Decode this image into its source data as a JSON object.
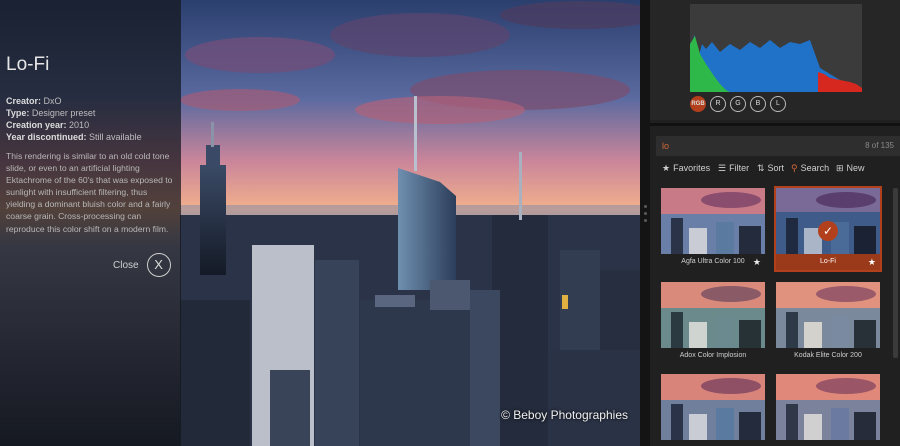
{
  "preset": {
    "name": "Lo-Fi",
    "creator_label": "Creator:",
    "creator": "DxO",
    "type_label": "Type:",
    "type": "Designer preset",
    "creation_year_label": "Creation year:",
    "creation_year": "2010",
    "discontinued_label": "Year discontinued:",
    "discontinued": "Still available",
    "description": "This rendering is similar to an old cold tone slide, or even to an artificial lighting Ektachrome of the 60's that was exposed to sunlight with insufficient filtering, thus yielding a dominant bluish color and a fairly coarse grain. Cross-processing can reproduce this color shift on a modern film.",
    "close_label": "Close",
    "close_icon": "X"
  },
  "photo": {
    "credit": "© Beboy Photographies"
  },
  "histogram": {
    "channels": [
      "RGB",
      "R",
      "G",
      "B",
      "L"
    ],
    "active_channel": "RGB"
  },
  "search": {
    "value": "lo",
    "count": "8 of 135"
  },
  "toolbar": {
    "favorites": "Favorites",
    "filter": "Filter",
    "sort": "Sort",
    "search": "Search",
    "new": "New"
  },
  "thumbnails": [
    {
      "label": "Agfa Ultra Color 100",
      "favorite": true,
      "selected": false
    },
    {
      "label": "Lo-Fi",
      "favorite": true,
      "selected": true
    },
    {
      "label": "Adox Color Implosion",
      "favorite": false,
      "selected": false
    },
    {
      "label": "Kodak Elite Color 200",
      "favorite": false,
      "selected": false
    },
    {
      "label": "",
      "favorite": false,
      "selected": false
    },
    {
      "label": "",
      "favorite": false,
      "selected": false
    }
  ],
  "colors": {
    "accent": "#b3401c",
    "search_text": "#d86a3a"
  }
}
